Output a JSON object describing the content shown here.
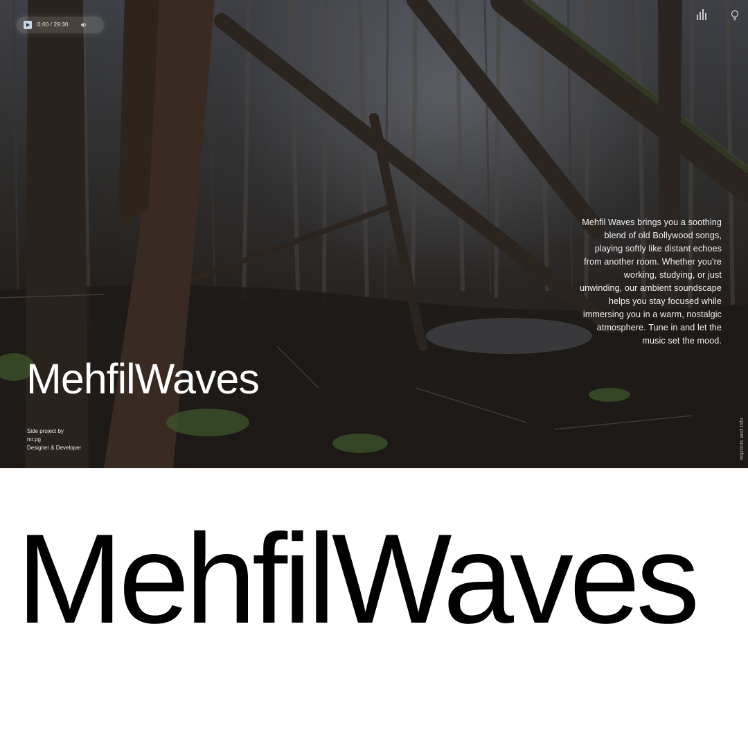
{
  "player": {
    "time": "0:00 / 29:30",
    "play_icon": "play-icon",
    "volume_icon": "volume-icon"
  },
  "top_right": {
    "icons": [
      "equalizer-icon",
      "lightbulb-icon"
    ]
  },
  "hero": {
    "description": "Mehfil Waves brings you a soothing blend of old Bollywood songs, playing softly like distant echoes from another room. Whether you're working, studying, or just unwinding, our ambient soundscape helps you stay focused while immersing you in a warm, nostalgic atmosphere. Tune in and let the music set the mood.",
    "title": "MehfilWaves",
    "credits": {
      "line1": "Side project by",
      "line2": "mr.pg",
      "line3": "Designer & Developer"
    },
    "side_link": "Imprints and Info"
  },
  "footer": {
    "big_title": "MehfilWaves"
  },
  "colors": {
    "play_button": "#c9d6ea",
    "text_light": "#ffffff",
    "text_dark": "#000000",
    "background": "#ffffff"
  }
}
